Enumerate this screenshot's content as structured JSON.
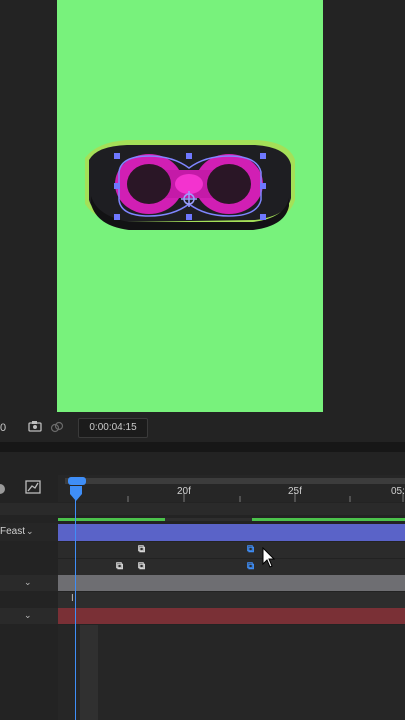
{
  "viewer": {
    "canvas_color": "#78f27c",
    "object": "portable bluetooth speaker (selected, with mask path and anchor point)"
  },
  "viewer_bar": {
    "left_value": "0",
    "timecode": "0:00:04:15"
  },
  "timeline": {
    "ruler_labels": [
      "20f",
      "25f",
      "05:"
    ],
    "layer_label": "Feast",
    "colors": {
      "playhead": "#3f8ef7",
      "layer_bar": "#5a63c8",
      "work_area": "#4bc24b",
      "red_layer": "#7a3036"
    }
  }
}
